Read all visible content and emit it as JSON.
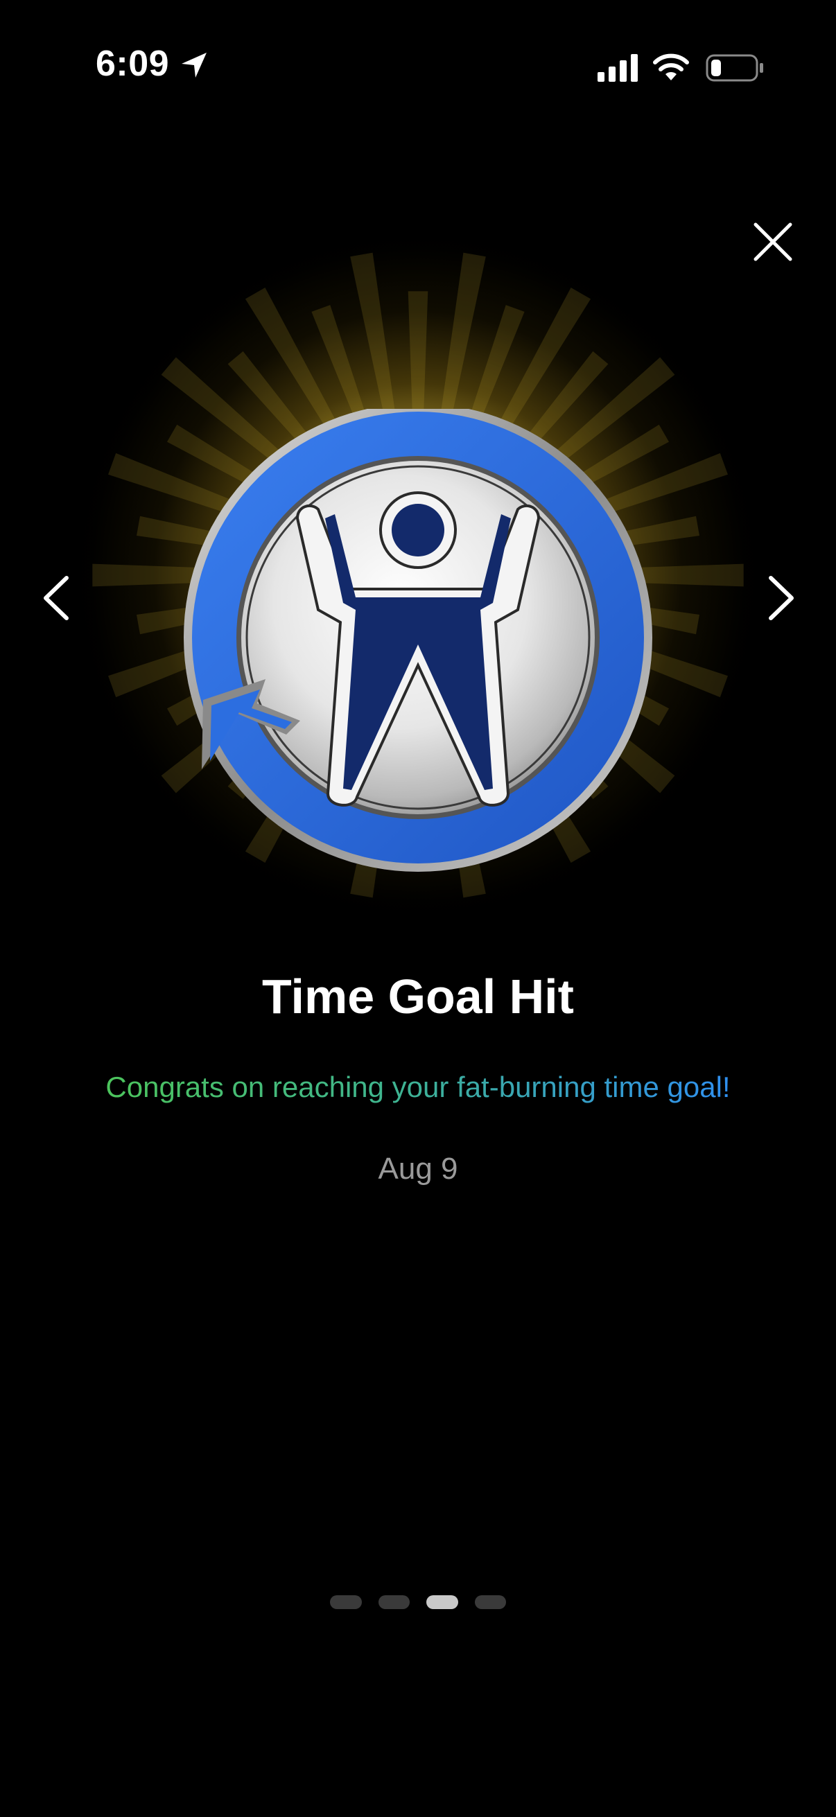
{
  "status_bar": {
    "time": "6:09",
    "icons": [
      "location-arrow-icon",
      "cellular-signal-icon",
      "wifi-icon",
      "battery-icon"
    ],
    "battery_level": 0.2
  },
  "controls": {
    "close_icon": "close-icon",
    "prev_icon": "chevron-left-icon",
    "next_icon": "chevron-right-icon"
  },
  "badge": {
    "icon": "person-arms-raised-circular-arrow-badge",
    "ring_color": "#2c6ee0",
    "figure_color": "#132a6b",
    "glow_color": "#e9c83c"
  },
  "achievement": {
    "title": "Time Goal Hit",
    "message": "Congrats on reaching your fat-burning time goal!",
    "date": "Aug 9",
    "message_gradient": [
      "#4cc45c",
      "#2f8ff0"
    ]
  },
  "pager": {
    "total": 4,
    "active_index": 2
  }
}
